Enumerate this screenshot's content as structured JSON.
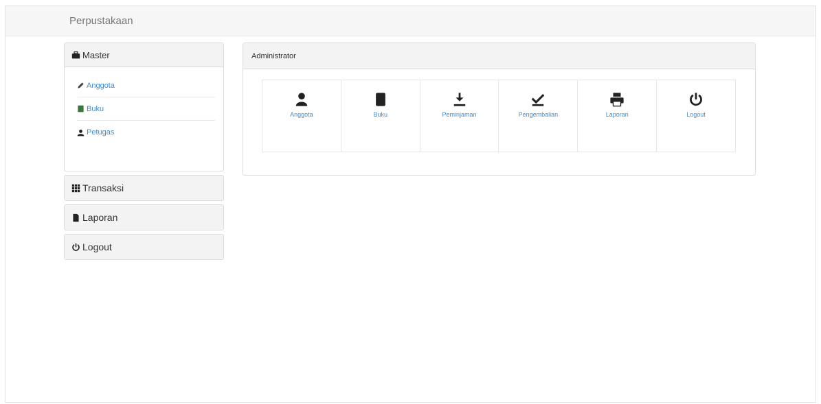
{
  "navbar": {
    "brand": "Perpustakaan"
  },
  "sidebar": {
    "master": {
      "label": "Master",
      "items": [
        {
          "label": "Anggota",
          "icon": "pencil-icon"
        },
        {
          "label": "Buku",
          "icon": "book-icon"
        },
        {
          "label": "Petugas",
          "icon": "user-icon"
        }
      ]
    },
    "transaksi": {
      "label": "Transaksi",
      "icon": "grid-icon"
    },
    "laporan": {
      "label": "Laporan",
      "icon": "file-icon"
    },
    "logout": {
      "label": "Logout",
      "icon": "power-icon"
    }
  },
  "main": {
    "title": "Administrator",
    "tiles": [
      {
        "label": "Anggota",
        "icon": "user-icon"
      },
      {
        "label": "Buku",
        "icon": "book-icon"
      },
      {
        "label": "Peminjaman",
        "icon": "download-icon"
      },
      {
        "label": "Pengembalian",
        "icon": "check-icon"
      },
      {
        "label": "Laporan",
        "icon": "print-icon"
      },
      {
        "label": "Logout",
        "icon": "power-icon"
      }
    ]
  },
  "colors": {
    "link": "#428bca",
    "heading_bg": "#f3f3f3",
    "navbar_bg": "#f6f6f6"
  }
}
